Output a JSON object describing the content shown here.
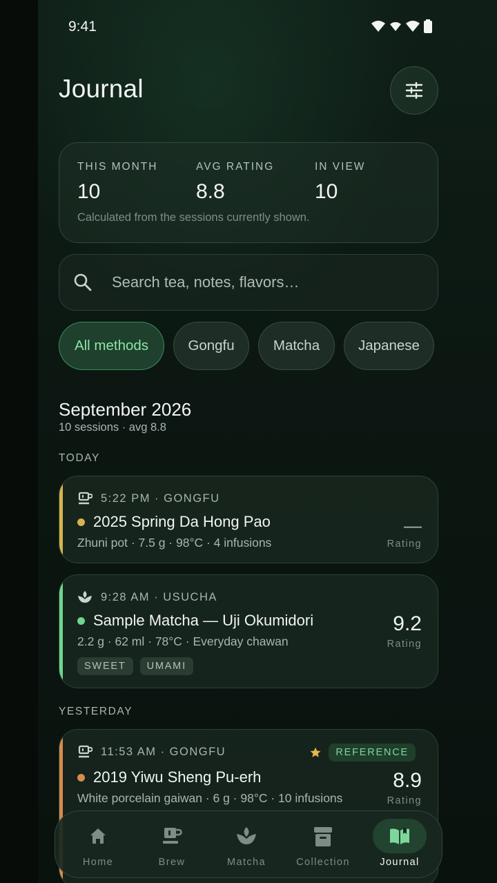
{
  "status_bar": {
    "time": "9:41"
  },
  "header": {
    "title": "Journal",
    "filter_icon": "sliders-icon"
  },
  "stats": [
    {
      "label": "THIS MONTH",
      "value": "10"
    },
    {
      "label": "AVG RATING",
      "value": "8.8"
    },
    {
      "label": "IN VIEW",
      "value": "10"
    }
  ],
  "stats_note": "Calculated from the sessions currently shown.",
  "search": {
    "placeholder": "Search tea, notes, flavors…",
    "value": ""
  },
  "filters": [
    {
      "label": "All methods",
      "active": true
    },
    {
      "label": "Gongfu",
      "active": false
    },
    {
      "label": "Matcha",
      "active": false
    },
    {
      "label": "Japanese",
      "active": false
    }
  ],
  "month": {
    "title": "September 2026",
    "subtitle": "10 sessions · avg 8.8"
  },
  "groups": [
    {
      "label": "TODAY",
      "sessions": [
        {
          "meta": "5:22 PM · GONGFU",
          "icon": "teapot-icon",
          "accent": "#d9b24e",
          "title": "2025 Spring Da Hong Pao",
          "details": "Zhuni pot · 7.5 g · 98°C · 4 infusions",
          "rating": "—",
          "rating_label": "Rating",
          "tags": []
        },
        {
          "meta": "9:28 AM · USUCHA",
          "icon": "leaf-icon",
          "accent": "#6fd68b",
          "title": "Sample Matcha — Uji Okumidori",
          "details": "2.2 g · 62 ml · 78°C · Everyday chawan",
          "rating": "9.2",
          "rating_label": "Rating",
          "tags": [
            "SWEET",
            "UMAMI"
          ]
        }
      ]
    },
    {
      "label": "YESTERDAY",
      "sessions": [
        {
          "meta": "11:53 AM · GONGFU",
          "icon": "teapot-icon",
          "accent": "#d98a4e",
          "title": "2019 Yiwu Sheng Pu-erh",
          "details": "White porcelain gaiwan · 6 g · 98°C · 10 infusions",
          "rating": "8.9",
          "rating_label": "Rating",
          "badge": "REFERENCE",
          "badge_icon": "star-icon",
          "tags": []
        }
      ]
    }
  ],
  "nav": [
    {
      "label": "Home",
      "icon": "home-icon",
      "active": false
    },
    {
      "label": "Brew",
      "icon": "teapot-icon",
      "active": false
    },
    {
      "label": "Matcha",
      "icon": "leaf-icon",
      "active": false
    },
    {
      "label": "Collection",
      "icon": "archive-icon",
      "active": false
    },
    {
      "label": "Journal",
      "icon": "book-icon",
      "active": true
    }
  ],
  "colors": {
    "accent_green": "#6fd68b",
    "star": "#e7b84a",
    "background": "#0b1410"
  }
}
